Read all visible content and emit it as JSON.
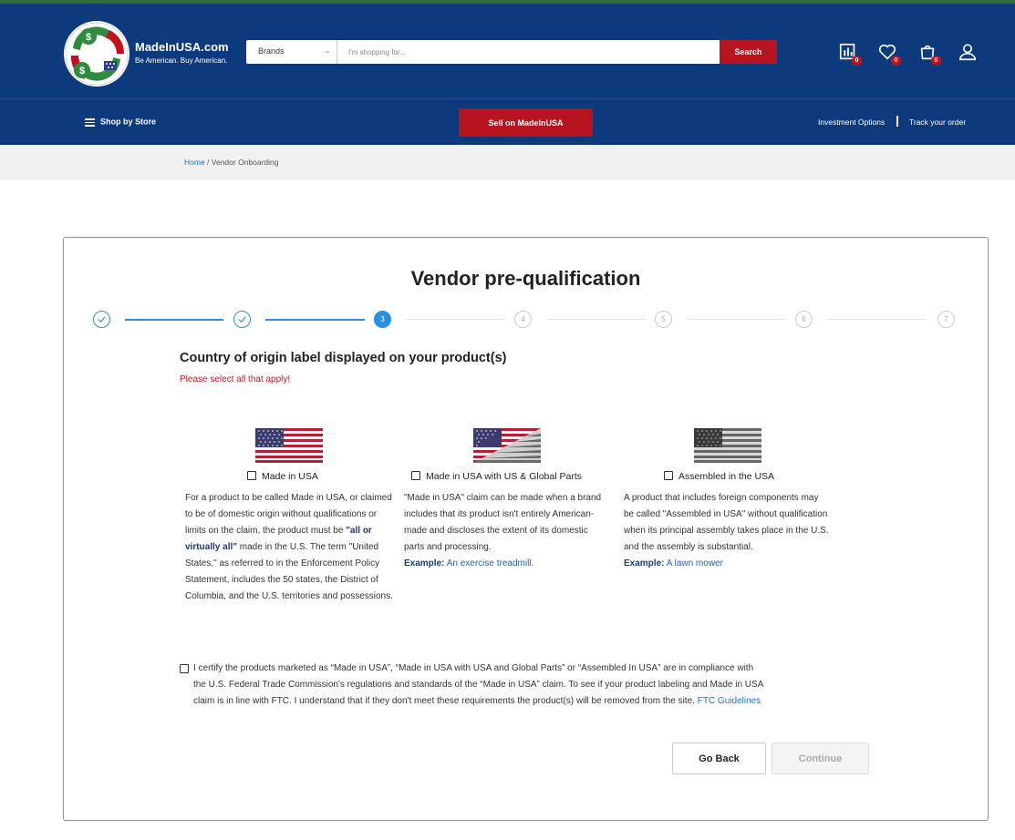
{
  "header": {
    "brand_name": "MadeInUSA.com",
    "brand_tagline": "Be American. Buy American.",
    "search": {
      "category": "Brands",
      "placeholder": "I'm shopping for...",
      "button_label": "Search"
    },
    "icons": [
      {
        "name": "compare-icon",
        "count": "0"
      },
      {
        "name": "heart-icon",
        "count": "0"
      },
      {
        "name": "cart-icon",
        "count": "0"
      },
      {
        "name": "user-icon"
      }
    ],
    "colors": {
      "header_bg": "#0d3a7d",
      "accent_red": "#b7141f",
      "top_strip": "#2d6e3a"
    }
  },
  "nav": {
    "shop_by_store": "Shop by Store",
    "sell_button": "Sell on MadeInUSA",
    "investment": "Investment Options",
    "track_order": "Track your order"
  },
  "breadcrumb": {
    "home": "Home",
    "separator": " / ",
    "current": "Vendor Onboarding"
  },
  "card": {
    "title": "Vendor pre-qualification",
    "steps": [
      {
        "label": "1",
        "state": "done"
      },
      {
        "label": "2",
        "state": "done"
      },
      {
        "label": "3",
        "state": "active"
      },
      {
        "label": "4",
        "state": "todo"
      },
      {
        "label": "5",
        "state": "todo"
      },
      {
        "label": "6",
        "state": "todo"
      },
      {
        "label": "7",
        "state": "todo"
      }
    ],
    "heading": "Country of origin label displayed on your product(s)",
    "warning": "Please select all that apply!",
    "options": [
      {
        "label": "Made in USA",
        "desc_before": "For a product to be called Made in USA, or claimed to be of domestic origin without qualifications or limits on the claim, the product must be ",
        "desc_bold": "\"all or virtually all\"",
        "desc_after": " made in the U.S. The term \"United States,\" as referred to in the Enforcement Policy Statement, includes the 50 states, the District of Columbia, and the U.S. territories and possessions."
      },
      {
        "label": "Made in USA with US & Global Parts",
        "desc": "\"Made in USA\" claim can be made when a brand includes that its product isn't entirely American-made and discloses the extent of its domestic parts and processing.",
        "example_label": "Example:",
        "example_text": " An exercise treadmill."
      },
      {
        "label": "Assembled in the USA",
        "desc": "A product that includes foreign components may be called \"Assembled in USA\" without qualification when its principal assembly takes place in the U.S. and the assembly is substantial.",
        "example_label": "Example:",
        "example_text": " A lawn mower"
      }
    ],
    "certify_text": "I certify the products marketed as “Made in USA”, “Made in USA with USA and Global Parts” or “Assembled In USA” are in compliance with the U.S. Federal Trade Commission's regulations and standards of the “Made in USA” claim. To see if your product labeling and Made in USA claim is in line with FTC. I understand that if they don't meet these requirements the product(s) will be removed from the site. ",
    "certify_link": "FTC Guidelines",
    "go_back": "Go Back",
    "continue": "Continue"
  }
}
